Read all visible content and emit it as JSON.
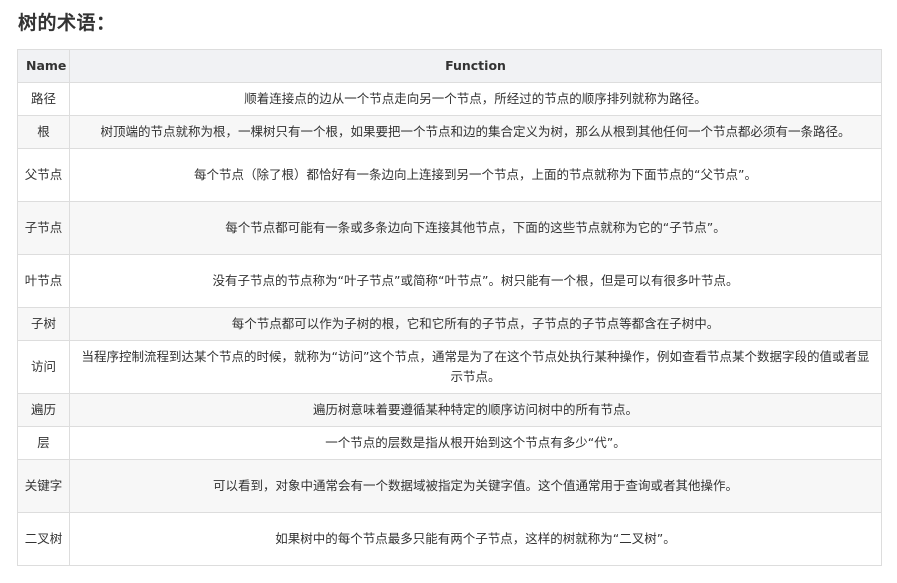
{
  "page": {
    "title": "树的术语："
  },
  "table": {
    "headers": {
      "name": "Name",
      "function": "Function"
    },
    "rows": [
      {
        "name": "路径",
        "function": "顺着连接点的边从一个节点走向另一个节点，所经过的节点的顺序排列就称为路径。"
      },
      {
        "name": "根",
        "function": "树顶端的节点就称为根，一棵树只有一个根，如果要把一个节点和边的集合定义为树，那么从根到其他任何一个节点都必须有一条路径。"
      },
      {
        "name": "父节点",
        "function": "每个节点（除了根）都恰好有一条边向上连接到另一个节点，上面的节点就称为下面节点的“父节点”。"
      },
      {
        "name": "子节点",
        "function": "每个节点都可能有一条或多条边向下连接其他节点，下面的这些节点就称为它的“子节点”。"
      },
      {
        "name": "叶节点",
        "function": "没有子节点的节点称为“叶子节点”或简称“叶节点”。树只能有一个根，但是可以有很多叶节点。"
      },
      {
        "name": "子树",
        "function": "每个节点都可以作为子树的根，它和它所有的子节点，子节点的子节点等都含在子树中。"
      },
      {
        "name": "访问",
        "function": "当程序控制流程到达某个节点的时候，就称为“访问”这个节点，通常是为了在这个节点处执行某种操作，例如查看节点某个数据字段的值或者显示节点。"
      },
      {
        "name": "遍历",
        "function": "遍历树意味着要遵循某种特定的顺序访问树中的所有节点。"
      },
      {
        "name": "层",
        "function": "一个节点的层数是指从根开始到这个节点有多少“代”。"
      },
      {
        "name": "关键字",
        "function": "可以看到，对象中通常会有一个数据域被指定为关键字值。这个值通常用于查询或者其他操作。"
      },
      {
        "name": "二叉树",
        "function": "如果树中的每个节点最多只能有两个子节点，这样的树就称为“二叉树”。"
      }
    ]
  }
}
